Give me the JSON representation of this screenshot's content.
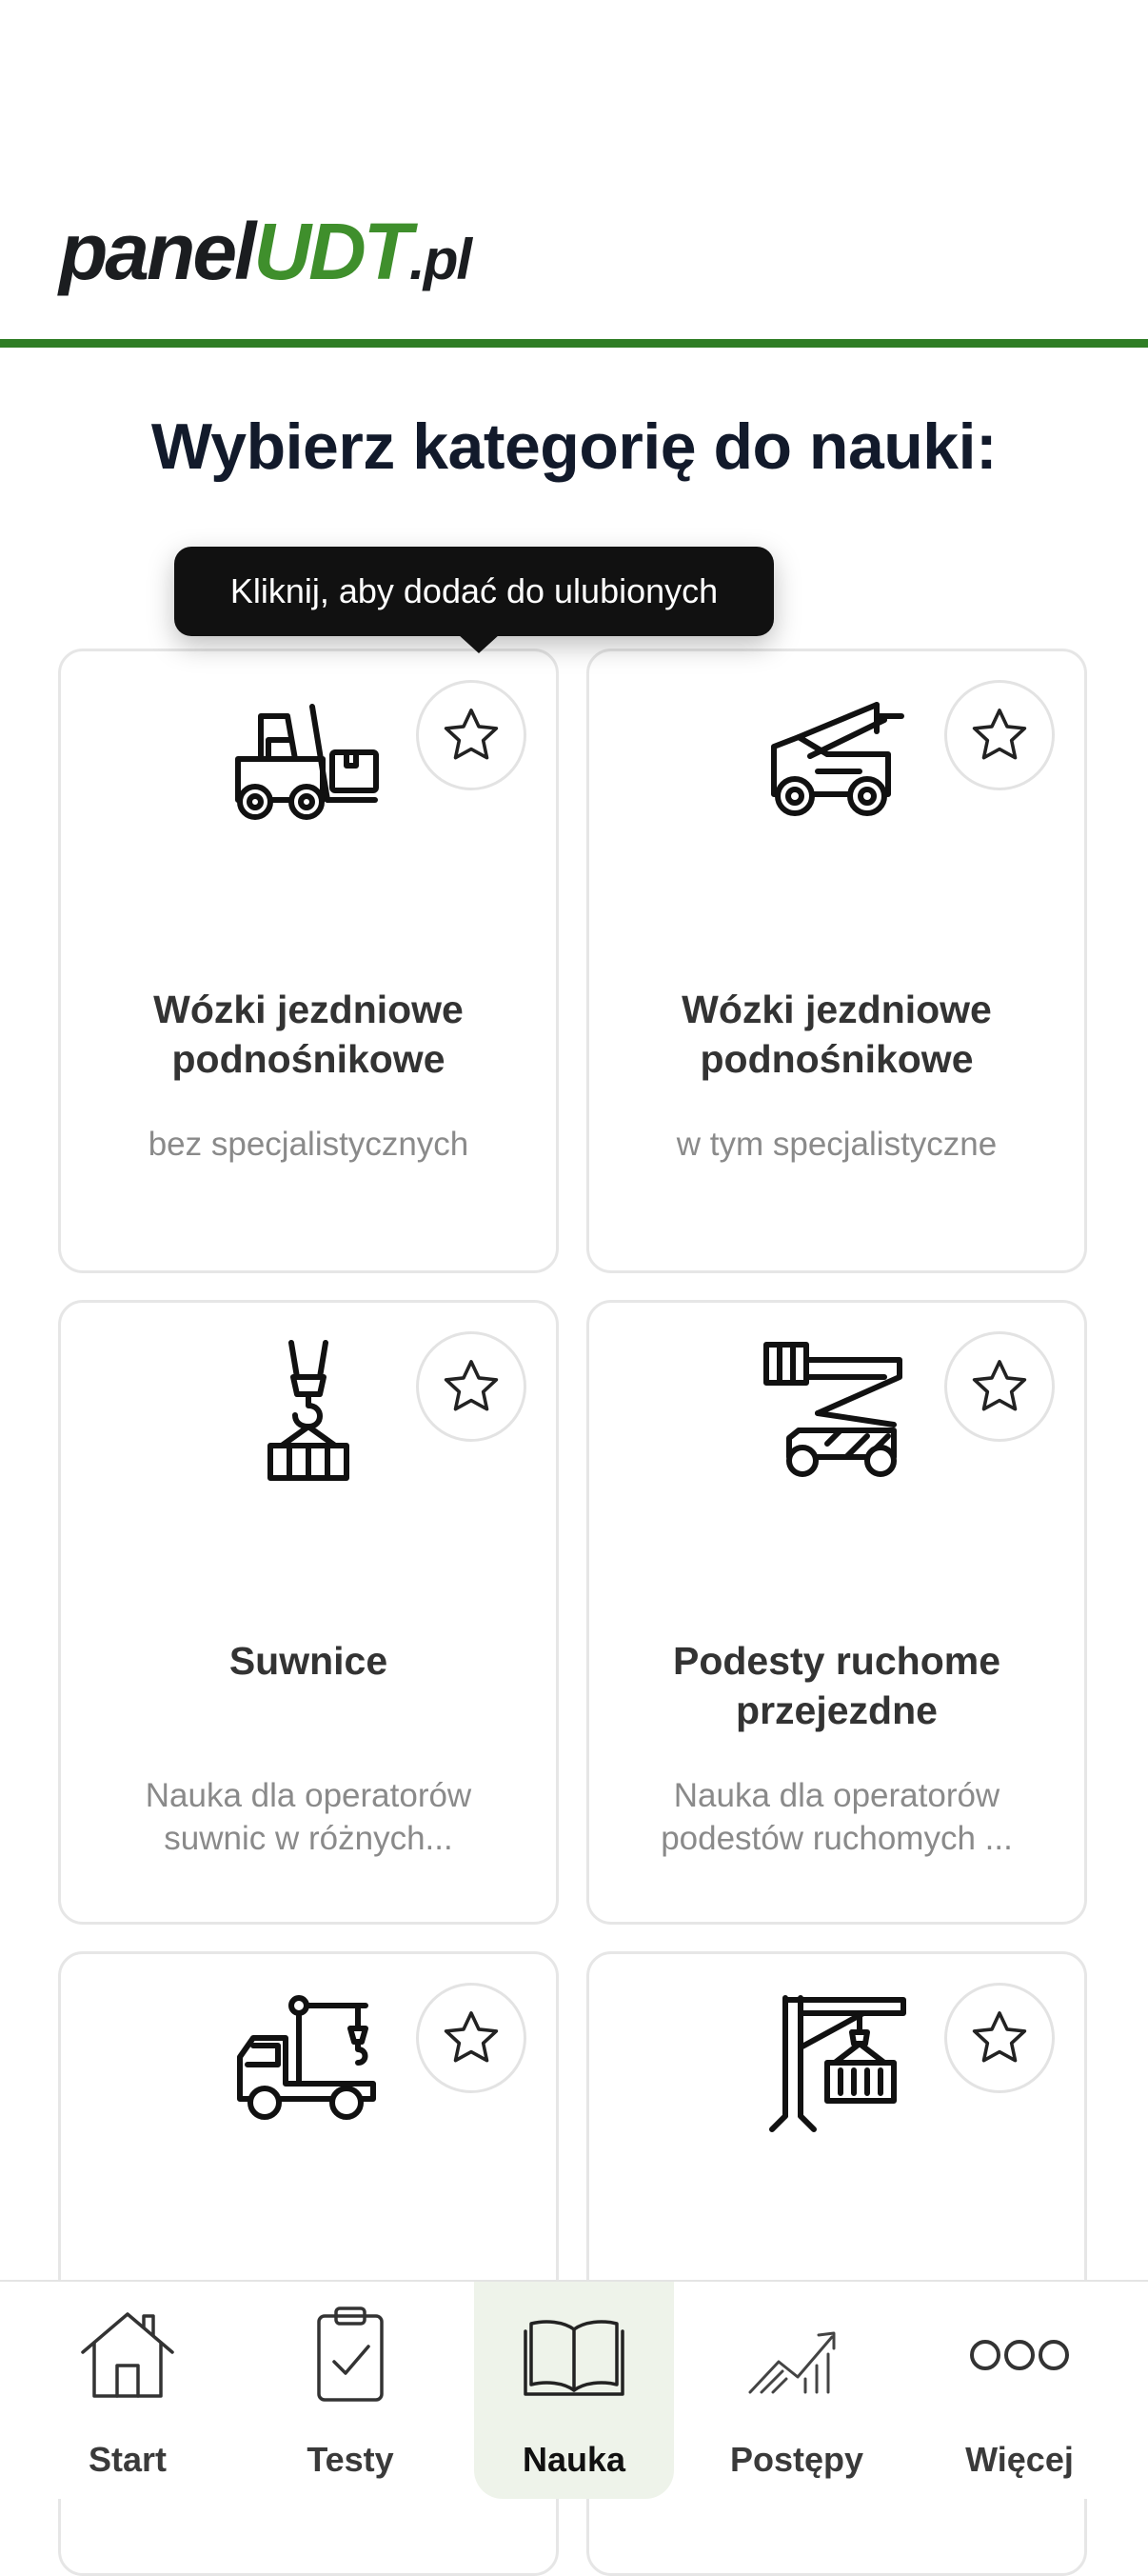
{
  "header": {
    "logo_part1": "panel",
    "logo_part2": "UDT",
    "logo_part3": ".pl"
  },
  "page_title": "Wybierz kategorię do nauki:",
  "tooltip": "Kliknij, aby dodać do ulubionych",
  "cards": [
    {
      "icon": "forklift-icon",
      "title": "Wózki jezdniowe\npodnośnikowe",
      "subtitle": "bez specjalistycznych"
    },
    {
      "icon": "telehandler-icon",
      "title": "Wózki jezdniowe\npodnośnikowe",
      "subtitle": "w tym specjalistyczne"
    },
    {
      "icon": "crane-hook-icon",
      "title": "Suwnice",
      "subtitle": "Nauka dla operatorów\nsuwnic w różnych..."
    },
    {
      "icon": "aerial-platform-icon",
      "title": "Podesty ruchome\nprzejezdne",
      "subtitle": "Nauka dla operatorów\npodestów ruchomych ..."
    },
    {
      "icon": "truck-crane-icon",
      "title": "",
      "subtitle": ""
    },
    {
      "icon": "jib-crane-icon",
      "title": "",
      "subtitle": ""
    }
  ],
  "tabs": [
    {
      "label": "Start",
      "icon": "home-icon"
    },
    {
      "label": "Testy",
      "icon": "clipboard-check-icon"
    },
    {
      "label": "Nauka",
      "icon": "book-icon",
      "active": true
    },
    {
      "label": "Postępy",
      "icon": "chart-trend-icon"
    },
    {
      "label": "Więcej",
      "icon": "more-icon"
    }
  ],
  "colors": {
    "brand_green": "#3f8f2c",
    "header_line": "#2f7d25",
    "active_tab_bg": "#eef3ea"
  }
}
